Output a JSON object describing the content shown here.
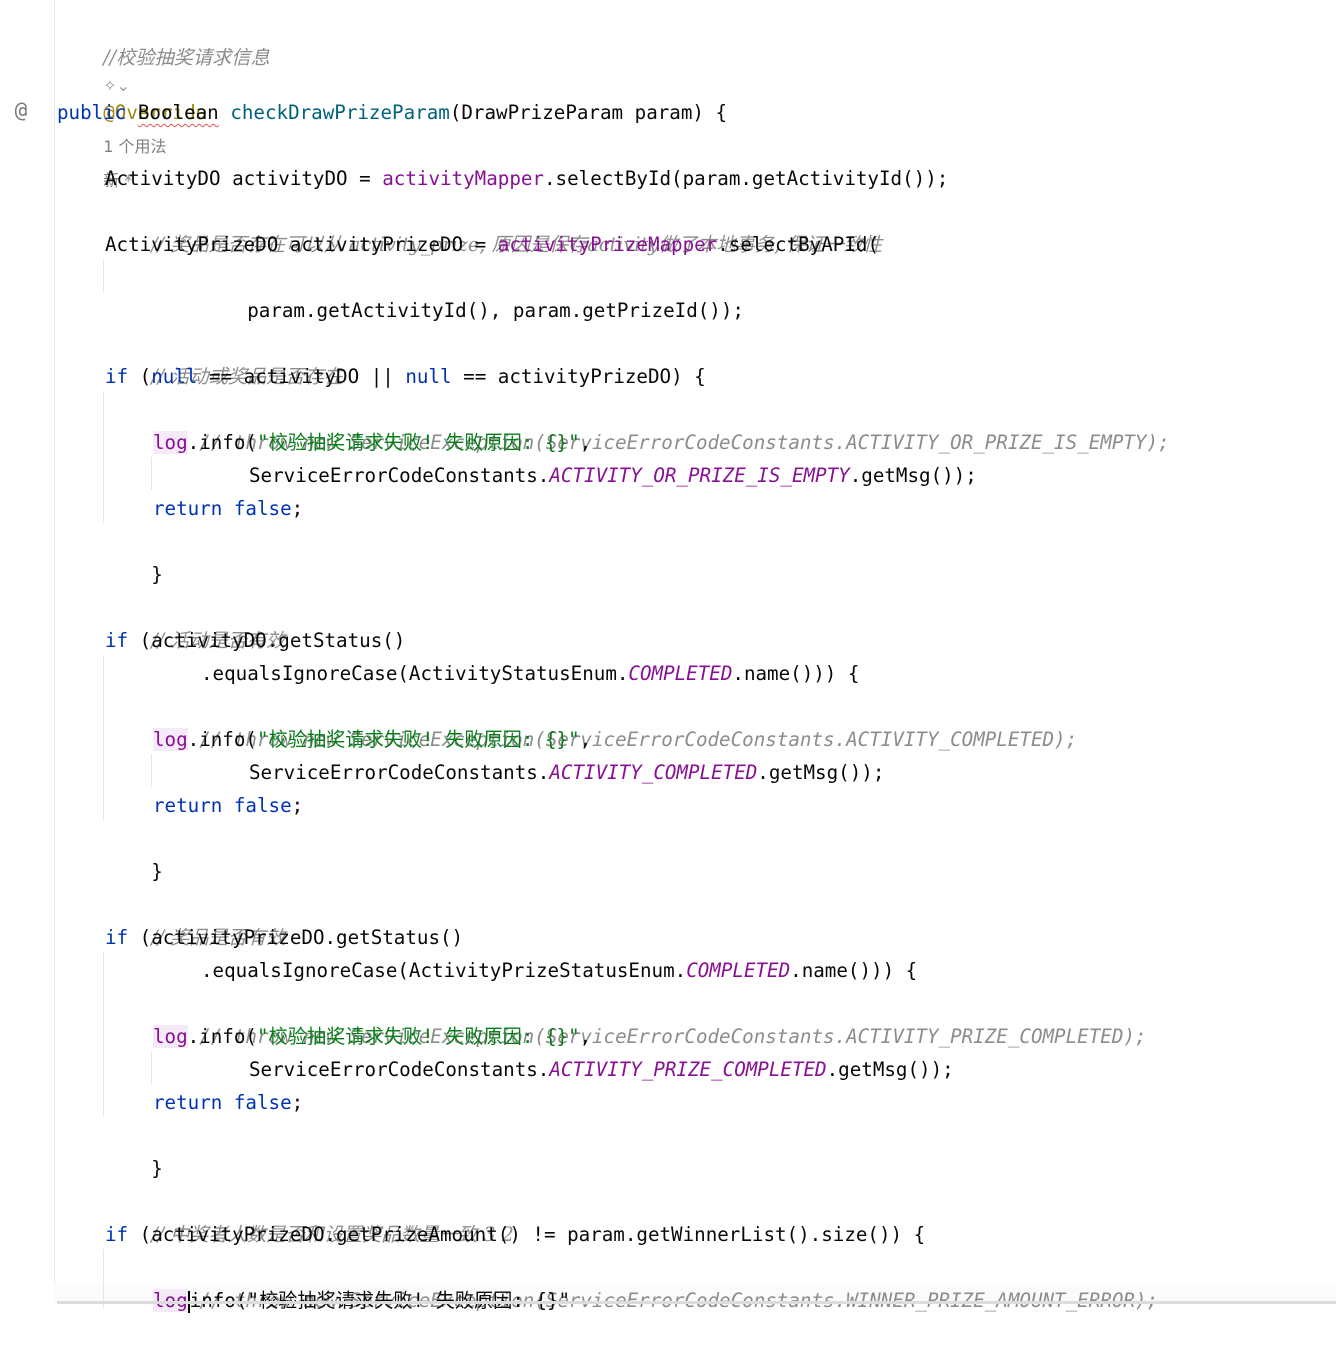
{
  "gutter": {
    "at_symbol": "@"
  },
  "hints": {
    "usages": "1 个用法",
    "new": "新 *"
  },
  "code": {
    "comment_verify": "//校验抽奖请求信息",
    "override": "@Override",
    "public": "public",
    "boolean": "Boolean",
    "method": "checkDrawPrizeParam",
    "params": "(DrawPrizeParam param) {",
    "l_act_type": "ActivityDO activityDO = ",
    "activity_mapper": "activityMapper",
    "l_act_call": ".selectById(param.getActivityId());",
    "comment_prize_exists": "// 奖品是否存在可以从 activity_prize, 原因是保存activity做了本地事务, 保证一致性",
    "l_prize_type": "ActivityPrizeDO activityPrizeDO = ",
    "activity_prize_mapper": "activityPrizeMapper",
    "l_prize_call": ".selectByAPId(",
    "l_prize_args": "param.getActivityId(), param.getPrizeId());",
    "comment_exists": "// 活动或奖品是否存在",
    "if_kw": "if",
    "null_kw": "null",
    "if1_a": " (",
    "if1_b": " == activityDO || ",
    "if1_c": " == activityPrizeDO) {",
    "throw1": "// throw new ServiceException(ServiceErrorCodeConstants.ACTIVITY_OR_PRIZE_IS_EMPTY);",
    "log": "log",
    "info_open": ".info(",
    "log_msg": "\"校验抽奖请求失败! 失败原因: {}\"",
    "comma": ",",
    "sec": "ServiceErrorCodeConstants.",
    "const_empty": "ACTIVITY_OR_PRIZE_IS_EMPTY",
    "get_msg": ".getMsg());",
    "return_kw": "return",
    "false_kw": "false",
    "semi": ";",
    "brace_close": "}",
    "comment_act_valid": "// 活动是否有效",
    "if2_a": " (activityDO.getStatus()",
    "eq_act": ".equalsIgnoreCase(ActivityStatusEnum.",
    "completed": "COMPLETED",
    "name_close": ".name())) {",
    "throw2": "// throw new ServiceException(ServiceErrorCodeConstants.ACTIVITY_COMPLETED);",
    "const_act_completed": "ACTIVITY_COMPLETED",
    "comment_prize_valid": "// 奖品是否有效",
    "if3_a": " (activityPrizeDO.getStatus()",
    "eq_prize": ".equalsIgnoreCase(ActivityPrizeStatusEnum.",
    "throw3": "// throw new ServiceException(ServiceErrorCodeConstants.ACTIVITY_PRIZE_COMPLETED);",
    "const_prize_completed": "ACTIVITY_PRIZE_COMPLETED",
    "comment_winner": "// 中奖者人数是否和设置奖品数量一致 3 2",
    "if4_a": " (activityPrizeDO.getPrizeAmount() != param.getWinnerList().size()) {",
    "throw4": "// throw new ServiceException(ServiceErrorCodeConstants.WINNER_PRIZE_AMOUNT_ERROR);",
    "last_log_rest": "info(\"校验抽奖请求失败! 失败原因: {}\""
  }
}
